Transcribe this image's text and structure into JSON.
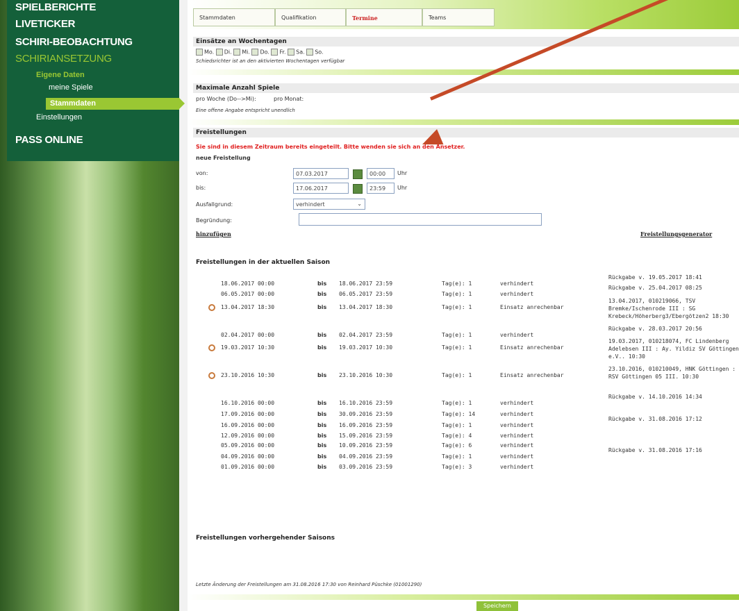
{
  "nav": {
    "items": [
      "SPIELBERICHTE",
      "LIVETICKER",
      "SCHIRI-BEOBACHTUNG",
      "SCHIRIANSETZUNG"
    ],
    "sub": {
      "eigene_daten": "Eigene Daten",
      "meine_spiele": "meine Spiele",
      "stammdaten": "Stammdaten",
      "einstellungen": "Einstellungen"
    },
    "pass_online": "PASS ONLINE"
  },
  "tabs": [
    "Stammdaten",
    "Qualifikation",
    "Termine",
    "Teams"
  ],
  "wochentage": {
    "title": "Einsätze an Wochentagen",
    "days": [
      "Mo.",
      "Di.",
      "Mi.",
      "Do.",
      "Fr.",
      "Sa.",
      "So."
    ],
    "note": "Schiedsrichter ist an den aktivierten Wochentagen verfügbar"
  },
  "max_spiele": {
    "title": "Maximale Anzahl Spiele",
    "pro_woche": "pro Woche (Do-->Mi):",
    "pro_monat": "pro Monat:",
    "note": "Eine offene Angabe entspricht unendlich"
  },
  "freistellungen": {
    "title": "Freistellungen",
    "error": "Sie sind in diesem Zeitraum bereits eingeteilt. Bitte wenden sie sich an den Ansetzer.",
    "neue": "neue Freistellung",
    "von_label": "von:",
    "von_date": "07.03.2017",
    "von_time": "00:00",
    "bis_label": "bis:",
    "bis_date": "17.06.2017",
    "bis_time": "23:59",
    "uhr": "Uhr",
    "ausfall_label": "Ausfallgrund:",
    "ausfall_value": "verhindert",
    "begruendung_label": "Begründung:",
    "add_link": "hinzufügen",
    "generator_link": "Freistellungsgenerator"
  },
  "aktuelle": {
    "title": "Freistellungen in der aktuellen Saison",
    "bis_word": "bis",
    "rows": [
      {
        "from": "18.06.2017 00:00",
        "to": "18.06.2017 23:59",
        "tage": "Tag(e): 1",
        "grund": "verhindert",
        "info": "Rückgabe v. 19.05.2017 18:41"
      },
      {
        "from": "06.05.2017 00:00",
        "to": "06.05.2017 23:59",
        "tage": "Tag(e): 1",
        "grund": "verhindert",
        "info": "Rückgabe v. 25.04.2017 08:25"
      },
      {
        "from": "13.04.2017 18:30",
        "to": "13.04.2017 18:30",
        "tage": "Tag(e): 1",
        "grund": "Einsatz anrechenbar",
        "info": "13.04.2017, 010219066, TSV Bremke/Ischenrode III : SG Krebeck/Höherberg3/Ebergötzen2 18:30"
      },
      {
        "from": "02.04.2017 00:00",
        "to": "02.04.2017 23:59",
        "tage": "Tag(e): 1",
        "grund": "verhindert",
        "info": "Rückgabe v. 28.03.2017 20:56"
      },
      {
        "from": "19.03.2017 10:30",
        "to": "19.03.2017 10:30",
        "tage": "Tag(e): 1",
        "grund": "Einsatz anrechenbar",
        "info": "19.03.2017, 010218074, FC Lindenberg Adelebsen III : Ay. Yildiz SV Göttingen e.V.. 10:30"
      },
      {
        "from": "23.10.2016 10:30",
        "to": "23.10.2016 10:30",
        "tage": "Tag(e): 1",
        "grund": "Einsatz anrechenbar",
        "info": "23.10.2016, 010210049, HNK Göttingen : RSV Göttingen 05 III. 10:30"
      },
      {
        "from": "16.10.2016 00:00",
        "to": "16.10.2016 23:59",
        "tage": "Tag(e): 1",
        "grund": "verhindert",
        "info": "Rückgabe v. 14.10.2016 14:34"
      },
      {
        "from": "17.09.2016 00:00",
        "to": "30.09.2016 23:59",
        "tage": "Tag(e): 14",
        "grund": "verhindert",
        "info": ""
      },
      {
        "from": "16.09.2016 00:00",
        "to": "16.09.2016 23:59",
        "tage": "Tag(e): 1",
        "grund": "verhindert",
        "info": "Rückgabe v. 31.08.2016 17:12"
      },
      {
        "from": "12.09.2016 00:00",
        "to": "15.09.2016 23:59",
        "tage": "Tag(e): 4",
        "grund": "verhindert",
        "info": ""
      },
      {
        "from": "05.09.2016 00:00",
        "to": "10.09.2016 23:59",
        "tage": "Tag(e): 6",
        "grund": "verhindert",
        "info": ""
      },
      {
        "from": "04.09.2016 00:00",
        "to": "04.09.2016 23:59",
        "tage": "Tag(e): 1",
        "grund": "verhindert",
        "info": "Rückgabe v. 31.08.2016 17:16"
      },
      {
        "from": "01.09.2016 00:00",
        "to": "03.09.2016 23:59",
        "tage": "Tag(e): 3",
        "grund": "verhindert",
        "info": ""
      }
    ]
  },
  "vorherige": {
    "title": "Freistellungen vorhergehender Saisons"
  },
  "footer": {
    "last_change": "Letzte Änderung der Freistellungen am 31.08.2016 17:30 von Reinhard Püschke (01001290)",
    "save": "Speichern"
  }
}
